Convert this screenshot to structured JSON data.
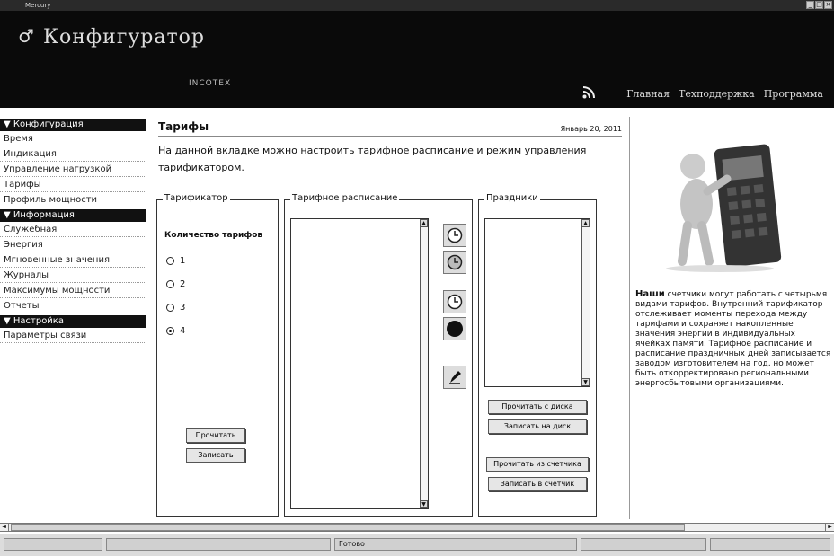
{
  "window": {
    "title": "Mercury",
    "min_glyph": "_",
    "max_glyph": "□",
    "close_glyph": "×"
  },
  "header": {
    "app_title": "Конфигуратор",
    "subtitle": "INCOTEX",
    "nav": [
      "Главная",
      "Техподдержка",
      "Программа"
    ]
  },
  "sidebar": {
    "sections": [
      {
        "heading": "▼ Конфигурация",
        "items": [
          "Время",
          "Индикация",
          "Управление нагрузкой",
          "Тарифы",
          "Профиль мощности"
        ]
      },
      {
        "heading": "▼ Информация",
        "items": [
          "Служебная",
          "Энергия",
          "Мгновенные значения",
          "Журналы",
          "Максимумы мощности",
          "Отчеты"
        ]
      },
      {
        "heading": "▼ Настройка",
        "items": [
          "Параметры связи"
        ]
      }
    ]
  },
  "main": {
    "title": "Тарифы",
    "date": "Январь 20, 2011",
    "description": "На данной вкладке можно настроить тарифное расписание и режим управления тарификатором.",
    "tariffer": {
      "label": "Тарификатор",
      "count_label": "Количество тарифов",
      "options": [
        "1",
        "2",
        "3",
        "4"
      ],
      "selected": "4",
      "read_button": "Прочитать",
      "write_button": "Записать"
    },
    "schedule": {
      "label": "Тарифное расписание",
      "tools": [
        "clock-add-icon",
        "clock-remove-icon",
        "clock-edit-icon",
        "record-icon",
        "pencil-icon"
      ]
    },
    "holidays": {
      "label": "Праздники",
      "read_disk": "Прочитать с диска",
      "write_disk": "Записать на диск",
      "read_meter": "Прочитать из счетчика",
      "write_meter": "Записать в счетчик"
    }
  },
  "promo": {
    "lead": "Наши",
    "text": "счетчики могут работать с четырьмя видами тарифов. Внутренний тарификатор отслеживает моменты перехода между тарифами и сохраняет накопленные значения энергии в индивидуальных ячейках памяти. Тарифное расписание и расписание праздничных дней записывается заводом изготовителем на год, но может быть откорректировано региональными энергосбытовыми организациями."
  },
  "scrollbar": {
    "left_glyph": "◄",
    "right_glyph": "►"
  },
  "status": {
    "text": "Готово"
  }
}
